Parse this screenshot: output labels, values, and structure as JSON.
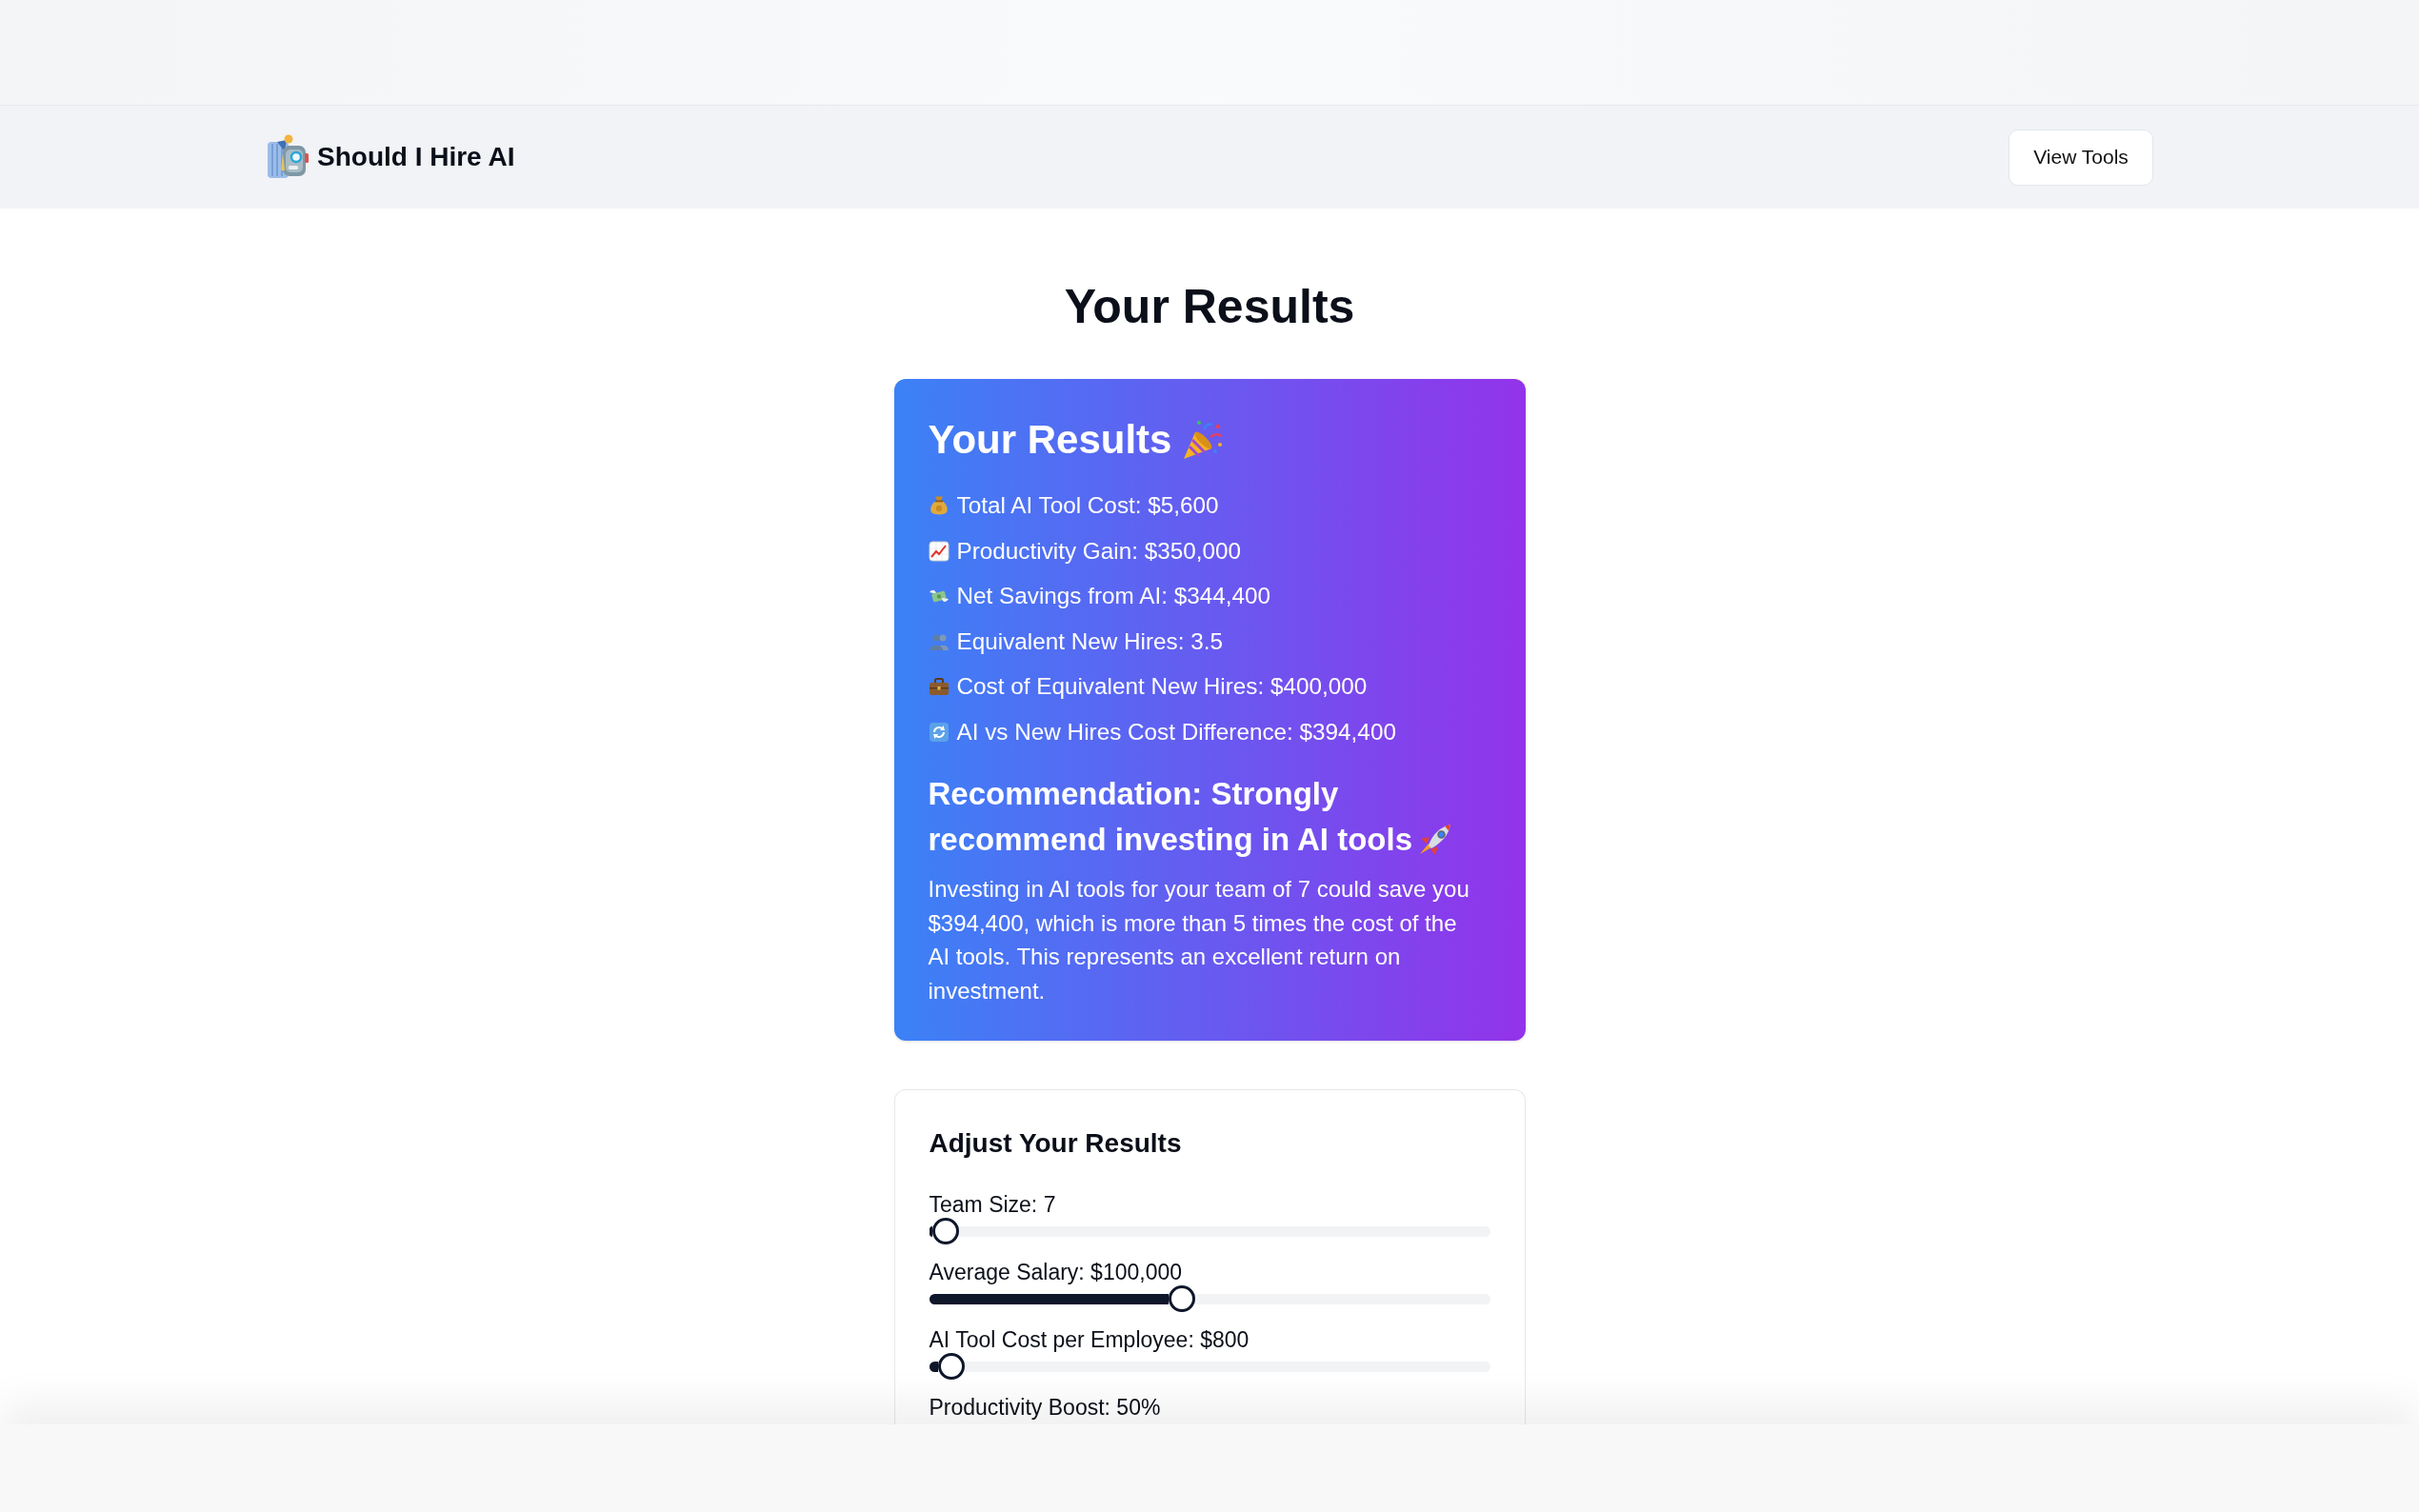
{
  "header": {
    "title": "Should I Hire AI",
    "button": "View Tools"
  },
  "page_title": "Your Results",
  "results_card": {
    "title": "Your Results",
    "items": [
      "Total AI Tool Cost: $5,600",
      "Productivity Gain: $350,000",
      "Net Savings from AI: $344,400",
      "Equivalent New Hires: 3.5",
      "Cost of Equivalent New Hires: $400,000",
      "AI vs New Hires Cost Difference: $394,400"
    ],
    "recommendation": {
      "title": "Recommendation: Strongly recommend investing in AI tools",
      "text": "Investing in AI tools for your team of 7 could save you $394,400, which is more than 5 times the cost of the AI tools. This represents an excellent return on investment."
    }
  },
  "adjust_panel": {
    "title": "Adjust Your Results",
    "sliders": [
      {
        "label": "Team Size: 7",
        "level": 0.03
      },
      {
        "label": "Average Salary: $100,000",
        "level": 0.45
      },
      {
        "label": "AI Tool Cost per Employee: $800",
        "level": 0.04
      },
      {
        "label": "Productivity Boost: 50%"
      }
    ]
  }
}
